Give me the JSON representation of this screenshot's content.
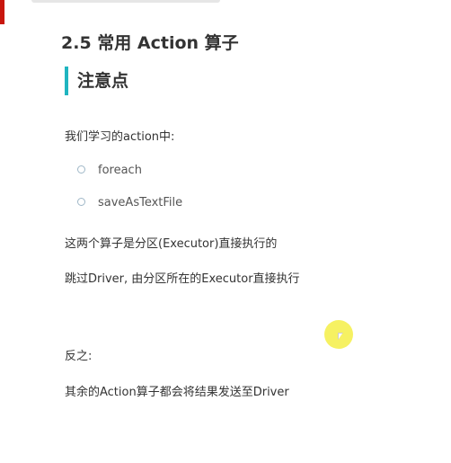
{
  "slide": {
    "title": "2.5 常用 Action 算子",
    "subheading": "注意点",
    "intro": "我们学习的action中:",
    "bullets": [
      "foreach",
      "saveAsTextFile"
    ],
    "line1": "这两个算子是分区(Executor)直接执行的",
    "line2": "跳过Driver, 由分区所在的Executor直接执行",
    "line3": "反之:",
    "line4": "其余的Action算子都会将结果发送至Driver"
  },
  "colors": {
    "accent": "#1fb5c0",
    "brand_bar": "#c8160e",
    "cursor_highlight": "#f5ee46"
  }
}
